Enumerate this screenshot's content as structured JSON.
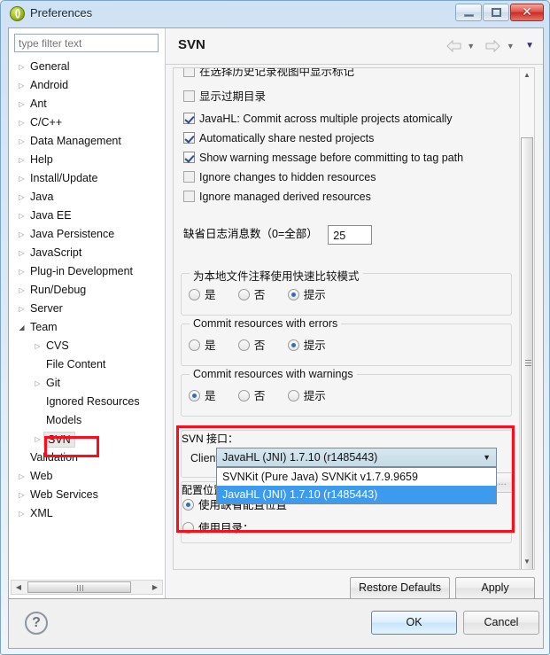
{
  "window": {
    "title": "Preferences",
    "icon": "eclipse-icon",
    "minimize_label": "",
    "maximize_label": "",
    "close_label": "✕"
  },
  "sidebar": {
    "filter_placeholder": "type filter text",
    "filter_value": "",
    "items": [
      {
        "label": "General",
        "indent": 0,
        "arrow": "collapsed"
      },
      {
        "label": "Android",
        "indent": 0,
        "arrow": "collapsed"
      },
      {
        "label": "Ant",
        "indent": 0,
        "arrow": "collapsed"
      },
      {
        "label": "C/C++",
        "indent": 0,
        "arrow": "collapsed"
      },
      {
        "label": "Data Management",
        "indent": 0,
        "arrow": "collapsed"
      },
      {
        "label": "Help",
        "indent": 0,
        "arrow": "collapsed"
      },
      {
        "label": "Install/Update",
        "indent": 0,
        "arrow": "collapsed"
      },
      {
        "label": "Java",
        "indent": 0,
        "arrow": "collapsed"
      },
      {
        "label": "Java EE",
        "indent": 0,
        "arrow": "collapsed"
      },
      {
        "label": "Java Persistence",
        "indent": 0,
        "arrow": "collapsed"
      },
      {
        "label": "JavaScript",
        "indent": 0,
        "arrow": "collapsed"
      },
      {
        "label": "Plug-in Development",
        "indent": 0,
        "arrow": "collapsed"
      },
      {
        "label": "Run/Debug",
        "indent": 0,
        "arrow": "collapsed"
      },
      {
        "label": "Server",
        "indent": 0,
        "arrow": "collapsed"
      },
      {
        "label": "Team",
        "indent": 0,
        "arrow": "expanded"
      },
      {
        "label": "CVS",
        "indent": 1,
        "arrow": "collapsed"
      },
      {
        "label": "File Content",
        "indent": 1,
        "arrow": "none"
      },
      {
        "label": "Git",
        "indent": 1,
        "arrow": "collapsed"
      },
      {
        "label": "Ignored Resources",
        "indent": 1,
        "arrow": "none"
      },
      {
        "label": "Models",
        "indent": 1,
        "arrow": "none"
      },
      {
        "label": "SVN",
        "indent": 1,
        "arrow": "collapsed",
        "selected": true,
        "highlighted": true
      },
      {
        "label": "Validation",
        "indent": 0,
        "arrow": "none"
      },
      {
        "label": "Web",
        "indent": 0,
        "arrow": "collapsed"
      },
      {
        "label": "Web Services",
        "indent": 0,
        "arrow": "collapsed"
      },
      {
        "label": "XML",
        "indent": 0,
        "arrow": "collapsed"
      }
    ]
  },
  "header": {
    "page_title": "SVN",
    "back_icon": "arrow-left-icon",
    "forward_icon": "arrow-right-icon",
    "menu_caret": "▼"
  },
  "main": {
    "checkboxes": [
      {
        "label": "在选择历史记录视图中显示标记",
        "checked": false,
        "clipped": true
      },
      {
        "label": "显示过期目录",
        "checked": false
      },
      {
        "label": "JavaHL: Commit across multiple projects atomically",
        "checked": true
      },
      {
        "label": "Automatically share nested projects",
        "checked": true
      },
      {
        "label": "Show warning message before committing to tag path",
        "checked": true
      },
      {
        "label": "Ignore changes to hidden resources",
        "checked": false
      },
      {
        "label": "Ignore managed derived resources",
        "checked": false
      }
    ],
    "log_messages": {
      "label": "缺省日志消息数（0=全部）",
      "value": "25"
    },
    "radio_groups": [
      {
        "title": "为本地文件注释使用快速比较模式",
        "options": [
          "是",
          "否",
          "提示"
        ],
        "selected": 2
      },
      {
        "title": "Commit resources with errors",
        "options": [
          "是",
          "否",
          "提示"
        ],
        "selected": 2
      },
      {
        "title": "Commit resources with warnings",
        "options": [
          "是",
          "否",
          "提示"
        ],
        "selected": 0
      }
    ],
    "svn_interface": {
      "group_title": "SVN 接口：",
      "client_label": "Client:",
      "selected_value": "JavaHL (JNI) 1.7.10 (r1485443)",
      "dropdown_arrow": "▼",
      "options": [
        {
          "label": "SVNKit (Pure Java) SVNKit v1.7.9.9659",
          "selected": false
        },
        {
          "label": "JavaHL (JNI) 1.7.10 (r1485443)",
          "selected": true
        }
      ],
      "highlight_color": "#fc0d1b"
    },
    "config_location": {
      "group_title": "配置位置：",
      "options": [
        {
          "label": "使用缺省配置位置",
          "selected": true
        },
        {
          "label": "使用目录：",
          "selected": false
        }
      ],
      "directory_value": "",
      "browse_label": "浏览..."
    },
    "restore_defaults_label": "Restore Defaults",
    "apply_label": "Apply"
  },
  "footer": {
    "help_label": "?",
    "ok_label": "OK",
    "cancel_label": "Cancel"
  }
}
